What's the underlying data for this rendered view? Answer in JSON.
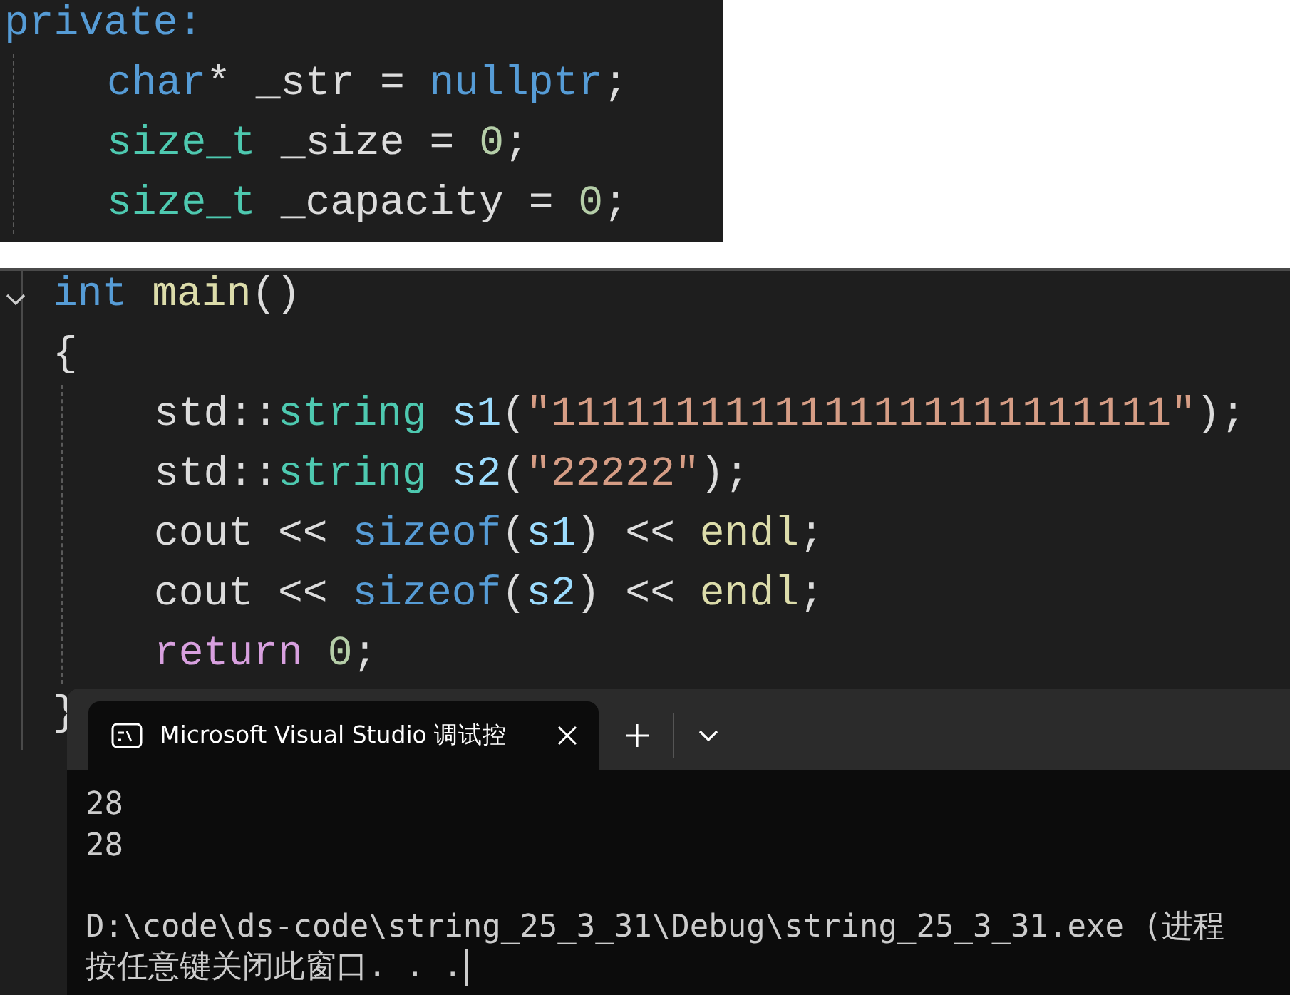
{
  "snippet": {
    "lines": [
      {
        "tokens": [
          {
            "text": "private:",
            "kind": "keyword"
          }
        ],
        "children": [
          {
            "tokens": [
              {
                "text": "char",
                "kind": "keyword"
              },
              {
                "text": "* _str = ",
                "kind": "plain"
              },
              {
                "text": "nullptr",
                "kind": "keyword"
              },
              {
                "text": ";",
                "kind": "plain"
              }
            ]
          },
          {
            "tokens": [
              {
                "text": "size_t",
                "kind": "type"
              },
              {
                "text": " _size = ",
                "kind": "plain"
              },
              {
                "text": "0",
                "kind": "number"
              },
              {
                "text": ";",
                "kind": "plain"
              }
            ]
          },
          {
            "tokens": [
              {
                "text": "size_t",
                "kind": "type"
              },
              {
                "text": " _capacity = ",
                "kind": "plain"
              },
              {
                "text": "0",
                "kind": "number"
              },
              {
                "text": ";",
                "kind": "plain"
              }
            ]
          }
        ]
      }
    ]
  },
  "editor": {
    "lines": [
      {
        "expanded": true,
        "tokens": [
          {
            "text": "int ",
            "kind": "keyword"
          },
          {
            "text": "main",
            "kind": "function"
          },
          {
            "text": "()",
            "kind": "plain"
          }
        ]
      },
      {
        "tokens": [
          {
            "text": "{",
            "kind": "plain"
          }
        ],
        "children": [
          {
            "tokens": [
              {
                "text": "std::",
                "kind": "plain"
              },
              {
                "text": "string ",
                "kind": "type"
              },
              {
                "text": "s1",
                "kind": "variable"
              },
              {
                "text": "(",
                "kind": "plain"
              },
              {
                "text": "\"1111111111111111111111111\"",
                "kind": "string"
              },
              {
                "text": ");",
                "kind": "plain"
              }
            ]
          },
          {
            "tokens": [
              {
                "text": "std::",
                "kind": "plain"
              },
              {
                "text": "string ",
                "kind": "type"
              },
              {
                "text": "s2",
                "kind": "variable"
              },
              {
                "text": "(",
                "kind": "plain"
              },
              {
                "text": "\"22222\"",
                "kind": "string"
              },
              {
                "text": ");",
                "kind": "plain"
              }
            ]
          },
          {
            "tokens": [
              {
                "text": "cout << ",
                "kind": "plain"
              },
              {
                "text": "sizeof",
                "kind": "keyword"
              },
              {
                "text": "(",
                "kind": "plain"
              },
              {
                "text": "s1",
                "kind": "variable"
              },
              {
                "text": ") << ",
                "kind": "plain"
              },
              {
                "text": "endl",
                "kind": "function"
              },
              {
                "text": ";",
                "kind": "plain"
              }
            ]
          },
          {
            "tokens": [
              {
                "text": "cout << ",
                "kind": "plain"
              },
              {
                "text": "sizeof",
                "kind": "keyword"
              },
              {
                "text": "(",
                "kind": "plain"
              },
              {
                "text": "s2",
                "kind": "variable"
              },
              {
                "text": ") << ",
                "kind": "plain"
              },
              {
                "text": "endl",
                "kind": "function"
              },
              {
                "text": ";",
                "kind": "plain"
              }
            ]
          },
          {
            "tokens": [
              {
                "text": "return ",
                "kind": "control"
              },
              {
                "text": "0",
                "kind": "number"
              },
              {
                "text": ";",
                "kind": "plain"
              }
            ]
          }
        ]
      },
      {
        "tokens": [
          {
            "text": "}",
            "kind": "plain"
          }
        ]
      }
    ]
  },
  "console": {
    "tabs": [
      {
        "title": "Microsoft Visual Studio 调试控",
        "selected": true
      }
    ],
    "output": [
      {
        "lines": [
          "28",
          "28"
        ]
      },
      {
        "lines": [
          "D:\\code\\ds-code\\string_25_3_31\\Debug\\string_25_3_31.exe (进程",
          "按任意键关闭此窗口. . ."
        ]
      }
    ]
  }
}
